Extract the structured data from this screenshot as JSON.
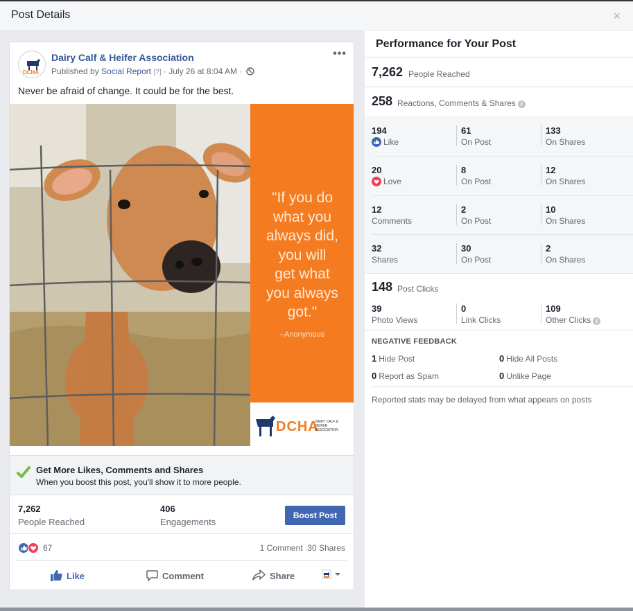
{
  "dialog": {
    "title": "Post Details",
    "close_glyph": "×"
  },
  "post": {
    "page_name": "Dairy Calf & Heifer Association",
    "published_by_prefix": "Published by ",
    "published_by_link": "Social Report",
    "help_marker": "[?]",
    "date_text": " · July 26 at 8:04 AM · ",
    "more_glyph": "•••",
    "text": "Never be afraid of change. It could be for the best.",
    "image": {
      "quote_lines": [
        "\"If you do",
        "what you",
        "always did,",
        "you will",
        "get what",
        "you always",
        "got.\""
      ],
      "quote_author": "–Anonymous",
      "logo_text": "DCHA",
      "logo_subtext": "DAIRY CALF & HEIFER ASSOCIATION",
      "avatar_text": "DCHA"
    }
  },
  "boost_banner": {
    "title": "Get More Likes, Comments and Shares",
    "subtitle": "When you boost this post, you'll show it to more people."
  },
  "summary": {
    "reached_value": "7,262",
    "reached_label": "People Reached",
    "engagements_value": "406",
    "engagements_label": "Engagements",
    "boost_button": "Boost Post"
  },
  "reactions": {
    "count": "67",
    "comments": "1 Comment",
    "shares": "30 Shares"
  },
  "actions": {
    "like": "Like",
    "comment": "Comment",
    "share": "Share"
  },
  "performance": {
    "title": "Performance for Your Post",
    "reached_value": "7,262",
    "reached_label": "People Reached",
    "engagement_value": "258",
    "engagement_label": "Reactions, Comments & Shares",
    "rows": [
      {
        "total": "194",
        "label": "Like",
        "on_post": "61",
        "on_post_label": "On Post",
        "on_shares": "133",
        "on_shares_label": "On Shares"
      },
      {
        "total": "20",
        "label": "Love",
        "on_post": "8",
        "on_post_label": "On Post",
        "on_shares": "12",
        "on_shares_label": "On Shares"
      },
      {
        "total": "12",
        "label": "Comments",
        "on_post": "2",
        "on_post_label": "On Post",
        "on_shares": "10",
        "on_shares_label": "On Shares"
      },
      {
        "total": "32",
        "label": "Shares",
        "on_post": "30",
        "on_post_label": "On Post",
        "on_shares": "2",
        "on_shares_label": "On Shares"
      }
    ],
    "clicks_value": "148",
    "clicks_label": "Post Clicks",
    "clicks": [
      {
        "value": "39",
        "label": "Photo Views"
      },
      {
        "value": "0",
        "label": "Link Clicks"
      },
      {
        "value": "109",
        "label": "Other Clicks"
      }
    ],
    "negative_title": "NEGATIVE FEEDBACK",
    "negative": [
      {
        "value": "1",
        "label": "Hide Post"
      },
      {
        "value": "0",
        "label": "Hide All Posts"
      },
      {
        "value": "0",
        "label": "Report as Spam"
      },
      {
        "value": "0",
        "label": "Unlike Page"
      }
    ],
    "footnote": "Reported stats may be delayed from what appears on posts"
  },
  "colors": {
    "brand_blue": "#4267b2",
    "link_blue": "#365899",
    "accent_orange": "#f47b20",
    "love_red": "#f33e58"
  },
  "icons": [
    "close-icon",
    "globe-icon",
    "check-icon",
    "like-icon",
    "love-icon",
    "comment-icon",
    "share-icon",
    "chevron-down-icon",
    "info-icon"
  ]
}
